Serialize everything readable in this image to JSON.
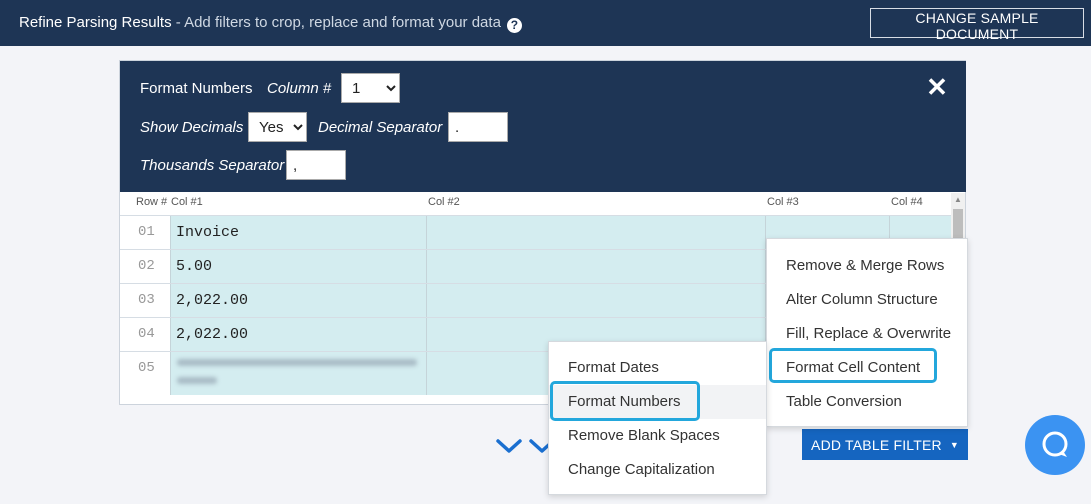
{
  "header": {
    "title": "Refine Parsing Results",
    "subtitle": " - Add filters to crop, replace and format your data",
    "help_icon": "?",
    "change_sample_label": "CHANGE SAMPLE DOCUMENT"
  },
  "format_panel": {
    "title": "Format Numbers",
    "column_label": "Column #",
    "column_value": "1",
    "show_decimals_label": "Show Decimals",
    "show_decimals_value": "Yes",
    "decimal_separator_label": "Decimal Separator",
    "decimal_separator_value": ".",
    "thousands_separator_label": "Thousands Separator",
    "thousands_separator_value": ",",
    "close_icon": "close-icon"
  },
  "table": {
    "columns": [
      "Row #",
      "Col #1",
      "Col #2",
      "Col #3",
      "Col #4"
    ],
    "rows": [
      {
        "num": "01",
        "col1": "Invoice"
      },
      {
        "num": "02",
        "col1": "5.00"
      },
      {
        "num": "03",
        "col1": "2,022.00"
      },
      {
        "num": "04",
        "col1": "2,022.00"
      },
      {
        "num": "05",
        "col1": ""
      }
    ]
  },
  "filter_menu": {
    "items": [
      "Remove & Merge Rows",
      "Alter Column Structure",
      "Fill, Replace & Overwrite",
      "Format Cell Content",
      "Table Conversion"
    ],
    "highlighted": "Format Cell Content"
  },
  "format_submenu": {
    "items": [
      "Format Dates",
      "Format Numbers",
      "Remove Blank Spaces",
      "Change Capitalization"
    ],
    "highlighted": "Format Numbers"
  },
  "add_filter_label": "ADD TABLE FILTER",
  "colors": {
    "header_bg": "#1e3555",
    "cell_bg": "#d4edf0",
    "button_blue": "#1565c0",
    "highlight": "#23a7dc",
    "chat_blue": "#3b93f2"
  }
}
